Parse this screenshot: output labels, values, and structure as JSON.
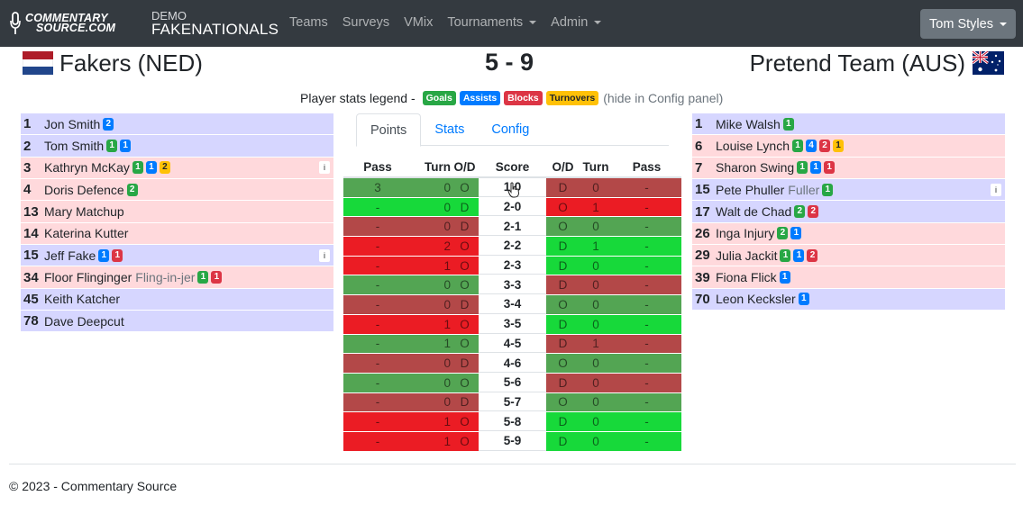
{
  "nav": {
    "logo_line1": "COMMENTARY",
    "logo_line2": "SOURCE.COM",
    "brand_small": "DEMO",
    "brand_big": "FAKENATIONALS",
    "links": [
      "Teams",
      "Surveys",
      "VMix",
      "Tournaments",
      "Admin"
    ],
    "user": "Tom Styles"
  },
  "match": {
    "home": "Fakers (NED)",
    "away": "Pretend Team (AUS)",
    "score": "5 - 9"
  },
  "legend": {
    "prefix": "Player stats legend -",
    "goals": "Goals",
    "assists": "Assists",
    "blocks": "Blocks",
    "turnovers": "Turnovers",
    "suffix": "(hide in Config panel)"
  },
  "home_players": [
    {
      "num": "1",
      "name": "Jon Smith",
      "alias": "",
      "color": "blue",
      "badges": [
        {
          "t": "blue",
          "v": "2"
        }
      ],
      "info": false
    },
    {
      "num": "2",
      "name": "Tom Smith",
      "alias": "",
      "color": "blue",
      "badges": [
        {
          "t": "green",
          "v": "1"
        },
        {
          "t": "blue",
          "v": "1"
        }
      ],
      "info": false
    },
    {
      "num": "3",
      "name": "Kathryn McKay",
      "alias": "",
      "color": "pink",
      "badges": [
        {
          "t": "green",
          "v": "1"
        },
        {
          "t": "blue",
          "v": "1"
        },
        {
          "t": "yellow",
          "v": "2"
        }
      ],
      "info": true
    },
    {
      "num": "4",
      "name": "Doris Defence",
      "alias": "",
      "color": "pink",
      "badges": [
        {
          "t": "green",
          "v": "2"
        }
      ],
      "info": false
    },
    {
      "num": "13",
      "name": "Mary Matchup",
      "alias": "",
      "color": "pink",
      "badges": [],
      "info": false
    },
    {
      "num": "14",
      "name": "Katerina Kutter",
      "alias": "",
      "color": "pink",
      "badges": [],
      "info": false
    },
    {
      "num": "15",
      "name": "Jeff Fake",
      "alias": "",
      "color": "blue",
      "badges": [
        {
          "t": "blue",
          "v": "1"
        },
        {
          "t": "red",
          "v": "1"
        }
      ],
      "info": true
    },
    {
      "num": "34",
      "name": "Floor Flinginger",
      "alias": "Fling-in-jer",
      "color": "pink",
      "badges": [
        {
          "t": "green",
          "v": "1"
        },
        {
          "t": "red",
          "v": "1"
        }
      ],
      "info": false
    },
    {
      "num": "45",
      "name": "Keith Katcher",
      "alias": "",
      "color": "blue",
      "badges": [],
      "info": false
    },
    {
      "num": "78",
      "name": "Dave Deepcut",
      "alias": "",
      "color": "blue",
      "badges": [],
      "info": false
    }
  ],
  "away_players": [
    {
      "num": "1",
      "name": "Mike Walsh",
      "alias": "",
      "color": "blue",
      "badges": [
        {
          "t": "green",
          "v": "1"
        }
      ],
      "info": false
    },
    {
      "num": "6",
      "name": "Louise Lynch",
      "alias": "",
      "color": "pink",
      "badges": [
        {
          "t": "green",
          "v": "1"
        },
        {
          "t": "blue",
          "v": "4"
        },
        {
          "t": "red",
          "v": "2"
        },
        {
          "t": "yellow",
          "v": "1"
        }
      ],
      "info": false
    },
    {
      "num": "7",
      "name": "Sharon Swing",
      "alias": "",
      "color": "pink",
      "badges": [
        {
          "t": "green",
          "v": "1"
        },
        {
          "t": "blue",
          "v": "1"
        },
        {
          "t": "red",
          "v": "1"
        }
      ],
      "info": false
    },
    {
      "num": "15",
      "name": "Pete Phuller",
      "alias": "Fuller",
      "color": "blue",
      "badges": [
        {
          "t": "green",
          "v": "1"
        }
      ],
      "info": true
    },
    {
      "num": "17",
      "name": "Walt de Chad",
      "alias": "",
      "color": "blue",
      "badges": [
        {
          "t": "green",
          "v": "2"
        },
        {
          "t": "red",
          "v": "2"
        }
      ],
      "info": false
    },
    {
      "num": "26",
      "name": "Inga Injury",
      "alias": "",
      "color": "pink",
      "badges": [
        {
          "t": "green",
          "v": "2"
        },
        {
          "t": "blue",
          "v": "1"
        }
      ],
      "info": false
    },
    {
      "num": "29",
      "name": "Julia Jackit",
      "alias": "",
      "color": "pink",
      "badges": [
        {
          "t": "green",
          "v": "1"
        },
        {
          "t": "blue",
          "v": "1"
        },
        {
          "t": "red",
          "v": "2"
        }
      ],
      "info": false
    },
    {
      "num": "39",
      "name": "Fiona Flick",
      "alias": "",
      "color": "pink",
      "badges": [
        {
          "t": "blue",
          "v": "1"
        }
      ],
      "info": false
    },
    {
      "num": "70",
      "name": "Leon Kecksler",
      "alias": "",
      "color": "blue",
      "badges": [
        {
          "t": "blue",
          "v": "1"
        }
      ],
      "info": false
    }
  ],
  "tabs": [
    "Points",
    "Stats",
    "Config"
  ],
  "points_headers": [
    "Pass",
    "Turn",
    "O/D",
    "Score",
    "O/D",
    "Turn",
    "Pass"
  ],
  "points": [
    {
      "lpass": "3",
      "lturn": "0",
      "lod": "O",
      "score": "1-0",
      "rod": "D",
      "rturn": "0",
      "rpass": "-",
      "lc": "g-dark",
      "rc": "r-dark"
    },
    {
      "lpass": "-",
      "lturn": "0",
      "lod": "D",
      "score": "2-0",
      "rod": "O",
      "rturn": "1",
      "rpass": "-",
      "lc": "g-light",
      "rc": "r-light"
    },
    {
      "lpass": "-",
      "lturn": "0",
      "lod": "D",
      "score": "2-1",
      "rod": "O",
      "rturn": "0",
      "rpass": "-",
      "lc": "r-dark",
      "rc": "g-dark"
    },
    {
      "lpass": "-",
      "lturn": "2",
      "lod": "O",
      "score": "2-2",
      "rod": "D",
      "rturn": "1",
      "rpass": "-",
      "lc": "r-light",
      "rc": "g-light"
    },
    {
      "lpass": "-",
      "lturn": "1",
      "lod": "O",
      "score": "2-3",
      "rod": "D",
      "rturn": "0",
      "rpass": "-",
      "lc": "r-light",
      "rc": "g-light"
    },
    {
      "lpass": "-",
      "lturn": "0",
      "lod": "O",
      "score": "3-3",
      "rod": "D",
      "rturn": "0",
      "rpass": "-",
      "lc": "g-dark",
      "rc": "r-dark"
    },
    {
      "lpass": "-",
      "lturn": "0",
      "lod": "D",
      "score": "3-4",
      "rod": "O",
      "rturn": "0",
      "rpass": "-",
      "lc": "r-dark",
      "rc": "g-dark"
    },
    {
      "lpass": "-",
      "lturn": "1",
      "lod": "O",
      "score": "3-5",
      "rod": "D",
      "rturn": "0",
      "rpass": "-",
      "lc": "r-light",
      "rc": "g-light"
    },
    {
      "lpass": "-",
      "lturn": "1",
      "lod": "O",
      "score": "4-5",
      "rod": "D",
      "rturn": "1",
      "rpass": "-",
      "lc": "g-dark",
      "rc": "r-dark"
    },
    {
      "lpass": "-",
      "lturn": "0",
      "lod": "D",
      "score": "4-6",
      "rod": "O",
      "rturn": "0",
      "rpass": "-",
      "lc": "r-dark",
      "rc": "g-dark"
    },
    {
      "lpass": "-",
      "lturn": "0",
      "lod": "O",
      "score": "5-6",
      "rod": "D",
      "rturn": "0",
      "rpass": "-",
      "lc": "g-dark",
      "rc": "r-dark"
    },
    {
      "lpass": "-",
      "lturn": "0",
      "lod": "D",
      "score": "5-7",
      "rod": "O",
      "rturn": "0",
      "rpass": "-",
      "lc": "r-dark",
      "rc": "g-dark"
    },
    {
      "lpass": "-",
      "lturn": "1",
      "lod": "O",
      "score": "5-8",
      "rod": "D",
      "rturn": "0",
      "rpass": "-",
      "lc": "r-light",
      "rc": "g-light"
    },
    {
      "lpass": "-",
      "lturn": "1",
      "lod": "O",
      "score": "5-9",
      "rod": "D",
      "rturn": "0",
      "rpass": "-",
      "lc": "r-light",
      "rc": "g-light"
    }
  ],
  "footer": "© 2023 - Commentary Source"
}
